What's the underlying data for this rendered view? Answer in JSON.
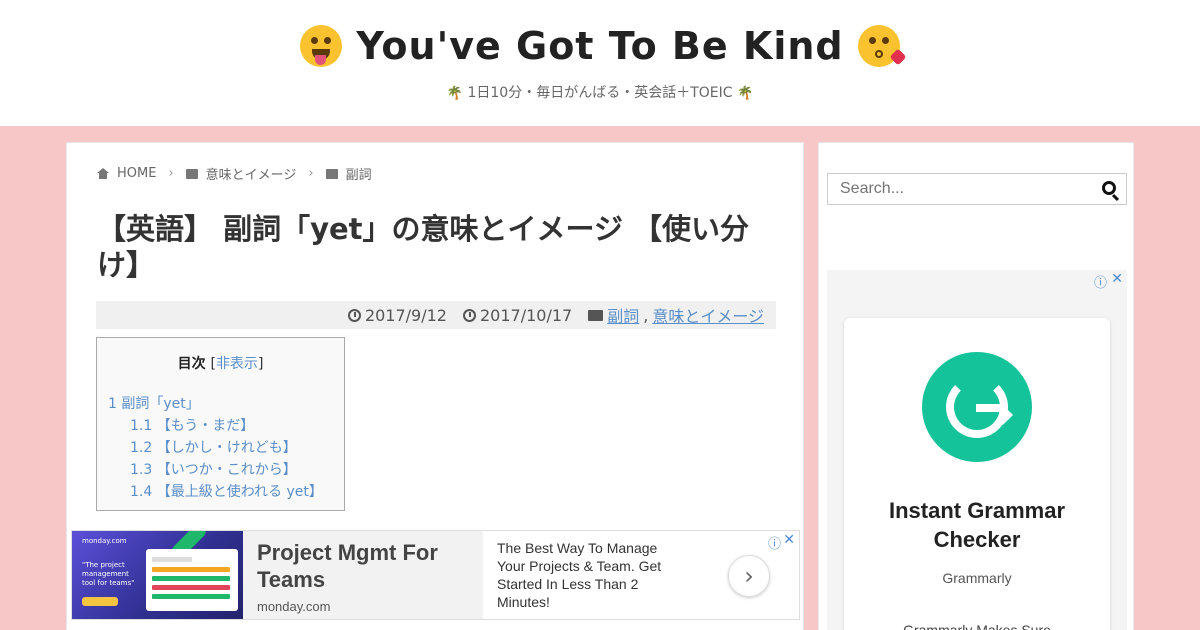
{
  "site": {
    "title": "You've Got To Be Kind",
    "tagline": "1日10分・毎日がんばる・英会話＋TOEIC",
    "tagline_icon": "🌴"
  },
  "breadcrumb": {
    "items": [
      "HOME",
      "意味とイメージ",
      "副詞"
    ],
    "separator": "›"
  },
  "post": {
    "title": "【英語】 副詞「yet」の意味とイメージ 【使い分け】",
    "published": "2017/9/12",
    "updated": "2017/10/17",
    "categories": [
      "副詞",
      "意味とイメージ"
    ],
    "category_separator": ","
  },
  "toc": {
    "heading": "目次",
    "toggle_label": "非表示",
    "bracket_open": "[",
    "bracket_close": "]",
    "items": [
      "1 副詞「yet」",
      "1.1 【もう・まだ】",
      "1.2 【しかし・けれども】",
      "1.3 【いつか・これから】",
      "1.4 【最上級と使われる yet】"
    ]
  },
  "banner_ad": {
    "headline": "Project Mgmt For Teams",
    "domain": "monday.com",
    "description": "The Best Way To Manage Your Projects & Team. Get Started In Less Than 2 Minutes!",
    "thumb_brand": "monday.com",
    "thumb_quote": "\"The project management tool for teams\"",
    "arrow": "›",
    "info": "ⓘ",
    "close": "✕"
  },
  "sidebar": {
    "search_placeholder": "Search...",
    "ad": {
      "title": "Instant Grammar Checker",
      "brand": "Grammarly",
      "description": "Grammarly Makes Sure",
      "info": "ⓘ",
      "close": "✕",
      "logo_color": "#15c39a"
    }
  },
  "colors": {
    "background": "#f7c6c7",
    "link": "#5a8ec9",
    "ad_accent": "#4a8ad4"
  }
}
